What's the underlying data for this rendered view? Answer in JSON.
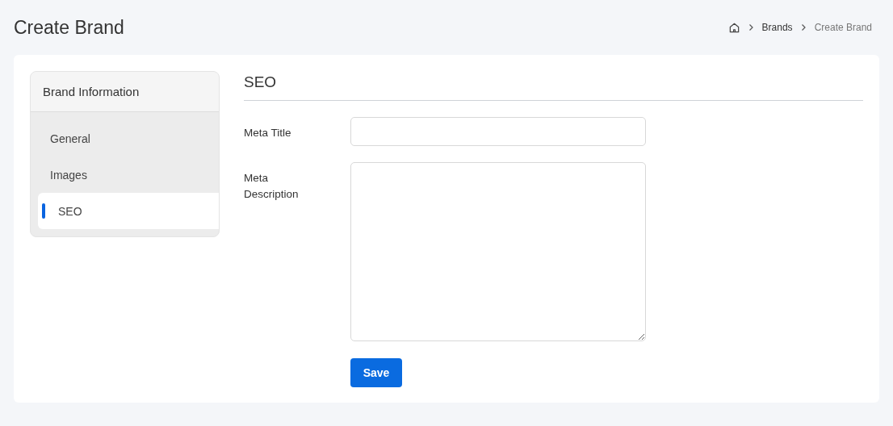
{
  "page_title": "Create Brand",
  "breadcrumb": [
    {
      "label": "Brands",
      "current": false
    },
    {
      "label": "Create Brand",
      "current": true
    }
  ],
  "sidebar": {
    "title": "Brand Information",
    "items": [
      {
        "label": "General",
        "selected": false
      },
      {
        "label": "Images",
        "selected": false
      },
      {
        "label": "SEO",
        "selected": true
      }
    ]
  },
  "section_title": "SEO",
  "fields": [
    {
      "kind": "input",
      "label": "Meta Title"
    },
    {
      "kind": "textarea",
      "label": "Meta Description"
    }
  ],
  "save_button": "Save"
}
